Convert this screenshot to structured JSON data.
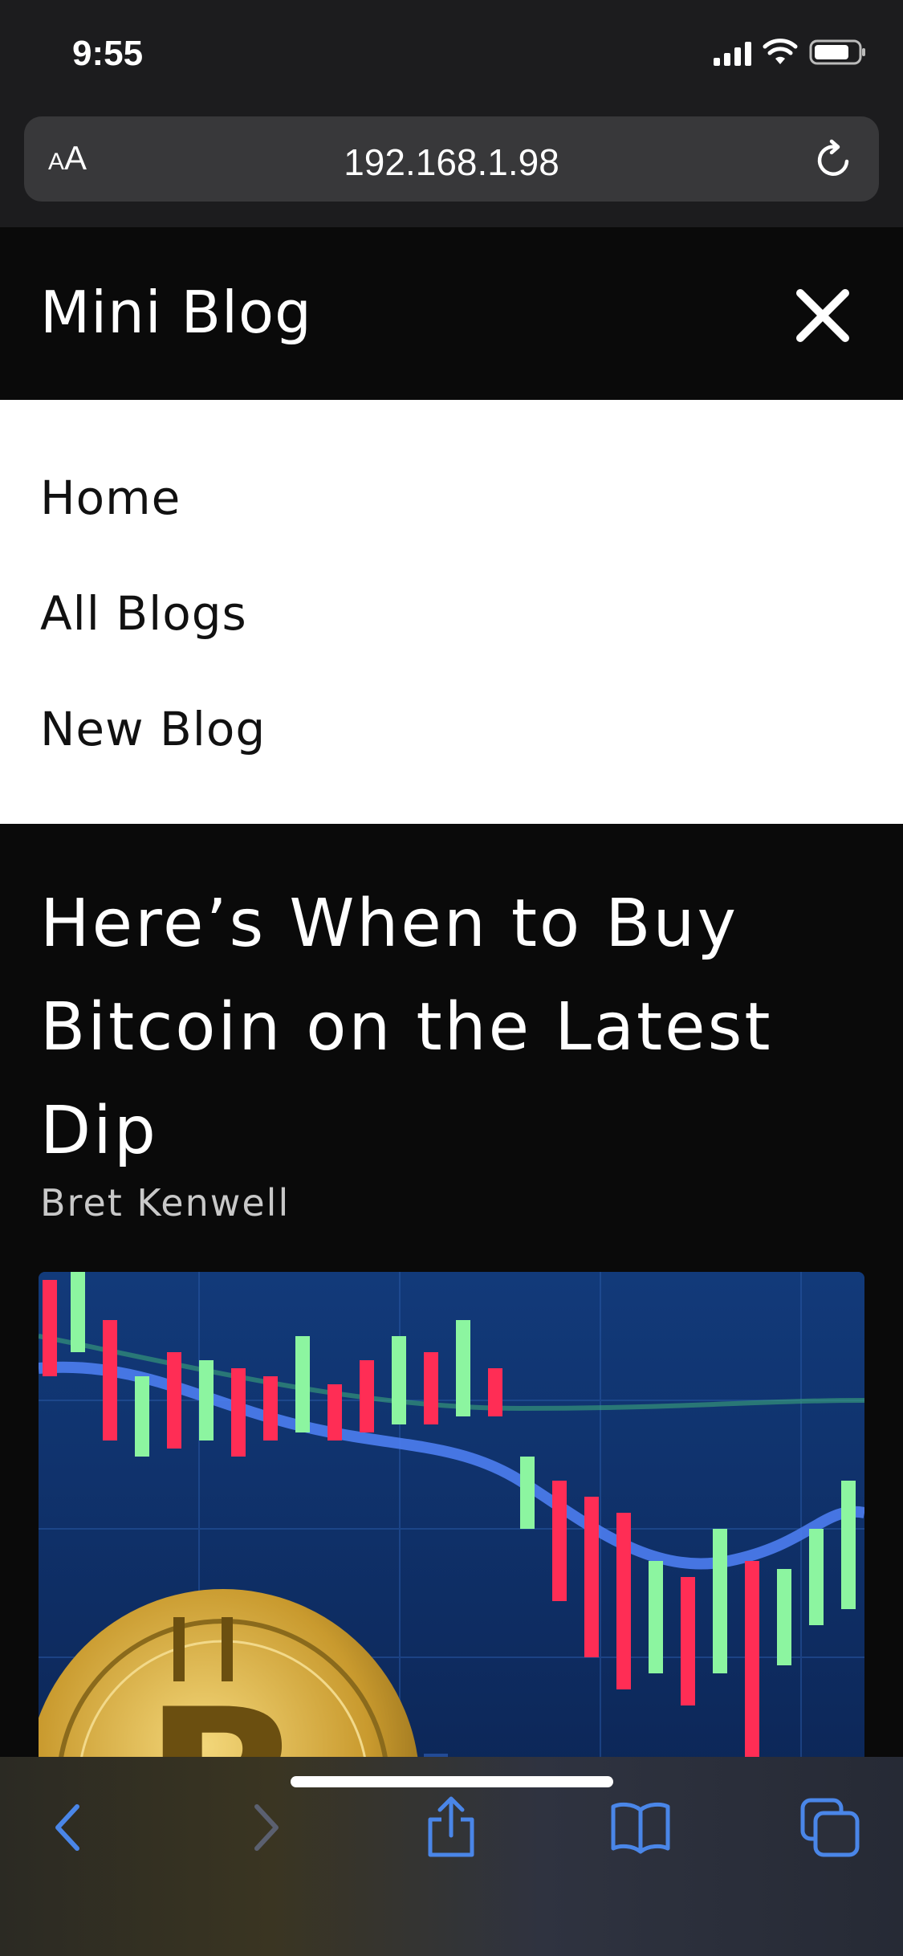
{
  "status_bar": {
    "time": "9:55"
  },
  "browser": {
    "aa_small": "A",
    "aa_large": "A",
    "url": "192.168.1.98"
  },
  "site": {
    "title": "Mini Blog",
    "menu": [
      {
        "label": "Home"
      },
      {
        "label": "All Blogs"
      },
      {
        "label": "New Blog"
      }
    ]
  },
  "article": {
    "title": "Here’s When to Buy Bitcoin on the Latest Dip",
    "author": "Bret Kenwell"
  },
  "colors": {
    "browser_chrome": "#1c1c1e",
    "url_field": "#38383a",
    "toolbar_accent": "#4a86e8",
    "site_header": "#0a0a0a"
  }
}
